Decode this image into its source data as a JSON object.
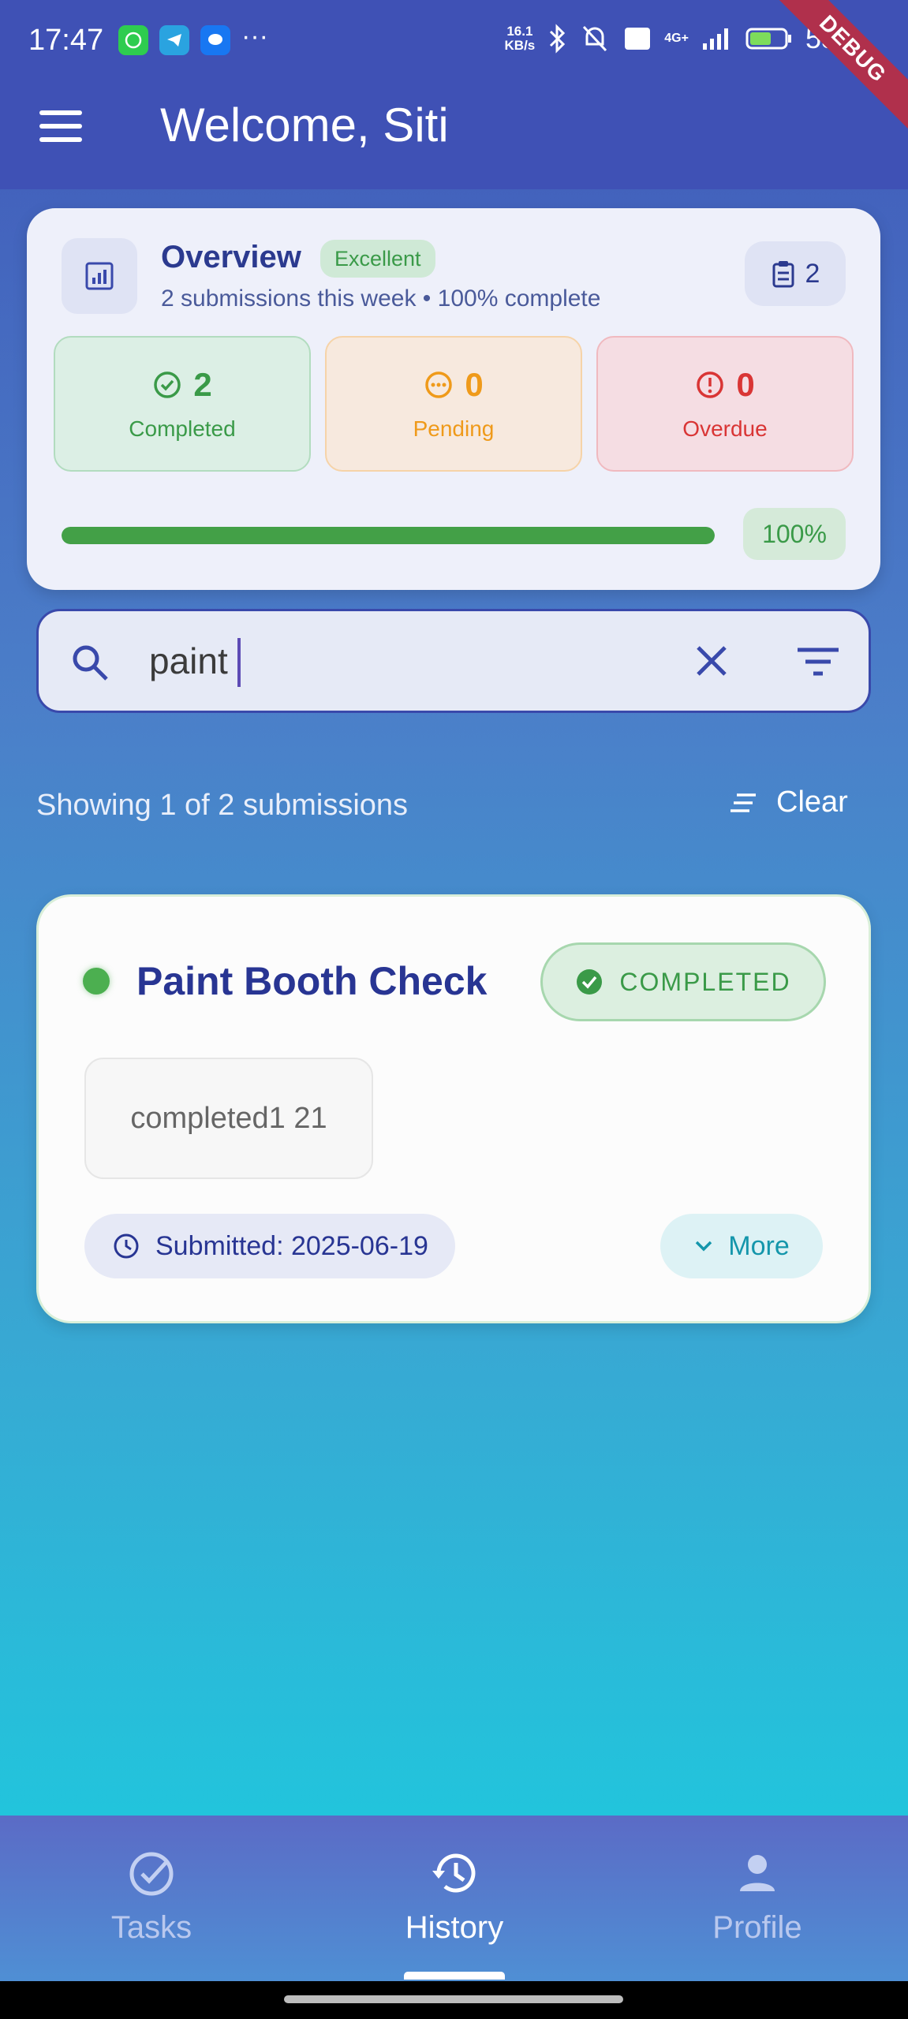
{
  "status_bar": {
    "time": "17:47",
    "net_speed_value": "16.1",
    "net_speed_unit": "KB/s",
    "network": "4G+",
    "battery": "55",
    "more": "···",
    "debug_label": "DEBUG"
  },
  "app_bar": {
    "title": "Welcome, Siti",
    "menu_icon": "hamburger-menu-icon"
  },
  "overview": {
    "title": "Overview",
    "badge": "Excellent",
    "subtitle": "2 submissions this week • 100% complete",
    "submission_count": "2",
    "stats": [
      {
        "value": "2",
        "label": "Completed",
        "color": "#3a9a48",
        "icon": "check-circle-icon"
      },
      {
        "value": "0",
        "label": "Pending",
        "color": "#ef9a1a",
        "icon": "more-circle-icon"
      },
      {
        "value": "0",
        "label": "Overdue",
        "color": "#d93535",
        "icon": "alert-circle-icon"
      }
    ],
    "progress_fraction": 1.0,
    "progress_label": "100%"
  },
  "search": {
    "value": "paint",
    "placeholder": ""
  },
  "results": {
    "summary": "Showing 1 of 2 submissions",
    "clear_label": "Clear"
  },
  "submissions": [
    {
      "title": "Paint Booth Check",
      "status": "COMPLETED",
      "status_color": "#3a9a48",
      "chip": "completed1 21",
      "submitted": "Submitted: 2025-06-19",
      "more_label": "More"
    }
  ],
  "bottom_nav": {
    "items": [
      {
        "label": "Tasks",
        "icon": "check-circle-icon",
        "active": false
      },
      {
        "label": "History",
        "icon": "history-icon",
        "active": true
      },
      {
        "label": "Profile",
        "icon": "person-icon",
        "active": false
      }
    ]
  }
}
